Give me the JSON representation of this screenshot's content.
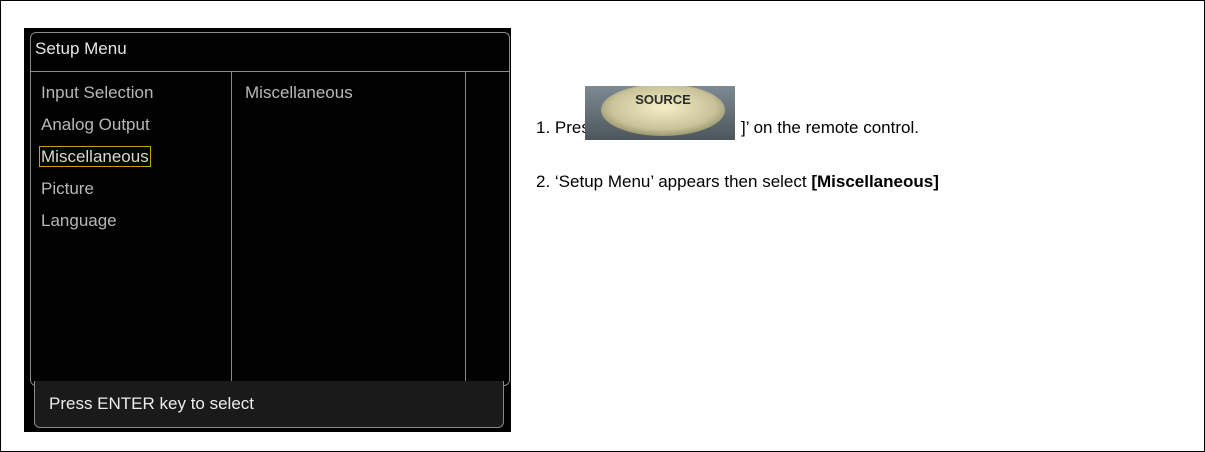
{
  "menu": {
    "title": "Setup Menu",
    "items": [
      {
        "label": "Input Selection"
      },
      {
        "label": "Analog Output"
      },
      {
        "label": "Miscellaneous",
        "selected": true
      },
      {
        "label": "Picture"
      },
      {
        "label": "Language"
      }
    ],
    "right_panel_title": "Miscellaneous",
    "status": "Press ENTER key to select"
  },
  "instructions": {
    "step1_prefix": "1. Press[",
    "step1_button_label": "SOURCE",
    "step1_suffix": "]’ on the remote control.",
    "step2_prefix": "2. ‘Setup Menu’ appears then select ",
    "step2_bold": "[Miscellaneous]"
  }
}
